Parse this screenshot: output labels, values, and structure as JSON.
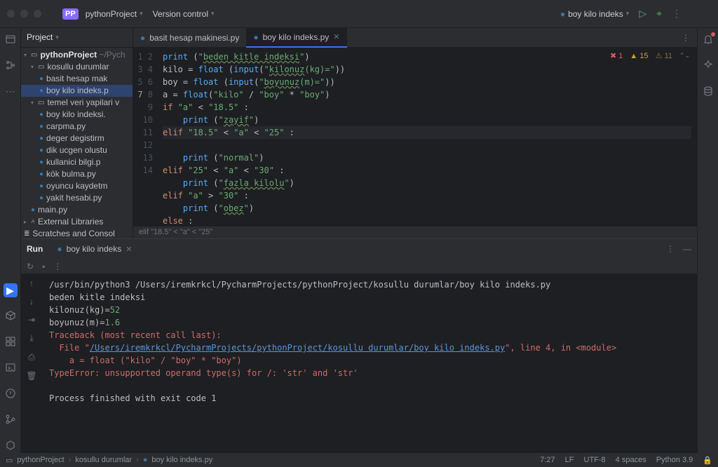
{
  "top": {
    "project": "pythonProject",
    "version_control": "Version control",
    "run_config": "boy kilo indeks"
  },
  "panel": {
    "project_label": "Project"
  },
  "tree": {
    "root": "pythonProject",
    "root_path": "~/Pych",
    "folder1": "kosullu durumlar",
    "f1a": "basit hesap mak",
    "f1b": "boy kilo indeks.p",
    "folder2": "temel veri yapilari v",
    "f2a": "boy kilo indeksi.",
    "f2b": "carpma.py",
    "f2c": "deger degistirm",
    "f2d": "dik ucgen olustu",
    "f2e": "kullanici bilgi.p",
    "f2f": "kök bulma.py",
    "f2g": "oyuncu kaydetm",
    "f2h": "yakit hesabi.py",
    "main": "main.py",
    "ext": "External Libraries",
    "scratch": "Scratches and Consol"
  },
  "tabs": {
    "t1": "basit hesap makinesi.py",
    "t2": "boy kilo indeks.py"
  },
  "analysis": {
    "err": "1",
    "warn": "15",
    "weak": "11"
  },
  "code_breadcrumb": "elif \"18.5\" < \"a\" < \"25\"",
  "run": {
    "label": "Run",
    "tab": "boy kilo indeks"
  },
  "console": {
    "cmd": "/usr/bin/python3 /Users/iremkrkcl/PycharmProjects/pythonProject/kosullu durumlar/boy kilo indeks.py",
    "out1": "beden kitle indeksi",
    "prompt1": "kilonuz(kg)=",
    "in1": "52",
    "prompt2": "boyunuz(m)=",
    "in2": "1.6",
    "tb1": "Traceback (most recent call last):",
    "tb2a": "  File \"",
    "tb2link": "/Users/iremkrkcl/PycharmProjects/pythonProject/kosullu durumlar/boy kilo indeks.py",
    "tb2b": "\", line 4, in <module>",
    "tb3": "    a = float (\"kilo\" / \"boy\" * \"boy\")",
    "tb4": "TypeError: unsupported operand type(s) for /: 'str' and 'str'",
    "exit": "Process finished with exit code 1"
  },
  "status": {
    "crumb1": "pythonProject",
    "crumb2": "kosullu durumlar",
    "crumb3": "boy kilo indeks.py",
    "pos": "7:27",
    "le": "LF",
    "enc": "UTF-8",
    "indent": "4 spaces",
    "interp": "Python 3.9"
  }
}
